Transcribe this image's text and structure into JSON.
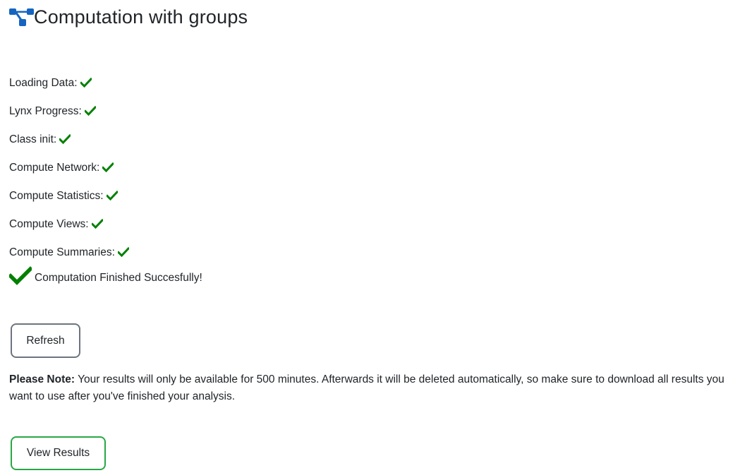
{
  "header": {
    "title": "Computation with groups",
    "icon": "sitemap-icon",
    "icon_color": "#1565c0"
  },
  "status": {
    "items": [
      {
        "label": "Loading Data:",
        "state": "done"
      },
      {
        "label": "Lynx Progress:",
        "state": "done"
      },
      {
        "label": "Class init:",
        "state": "done"
      },
      {
        "label": "Compute Network:",
        "state": "done"
      },
      {
        "label": "Compute Statistics:",
        "state": "done"
      },
      {
        "label": "Compute Views:",
        "state": "done"
      },
      {
        "label": "Compute Summaries:",
        "state": "done"
      }
    ],
    "check_icon": "check-icon",
    "check_color": "#008000"
  },
  "finished": {
    "message": "Computation Finished Succesfully!"
  },
  "buttons": {
    "refresh_label": "Refresh",
    "view_results_label": "View Results",
    "refresh_border_color": "#6c757d",
    "view_results_border_color": "#28a745"
  },
  "note": {
    "strong": "Please Note:",
    "text": " Your results will only be available for 500 minutes. Afterwards it will be deleted automatically, so make sure to download all results you want to use after you've finished your analysis."
  }
}
